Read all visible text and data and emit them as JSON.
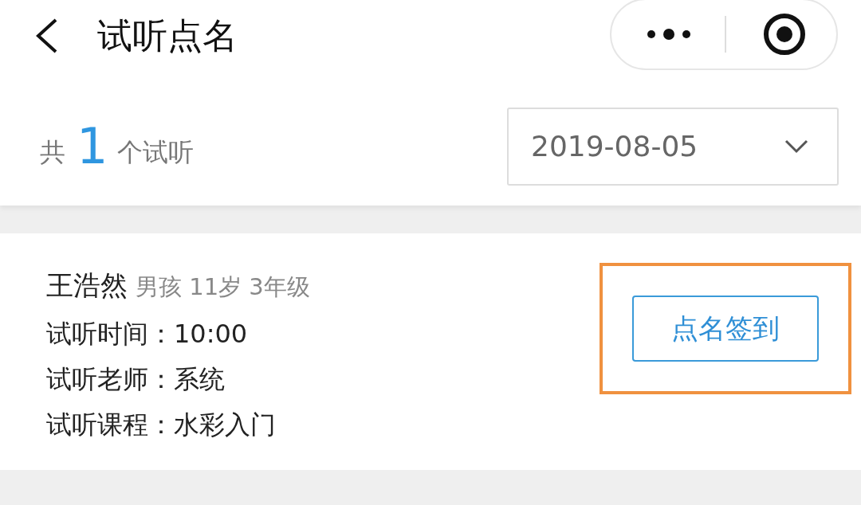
{
  "header": {
    "title": "试听点名"
  },
  "summary": {
    "prefix": "共",
    "count": "1",
    "suffix": "个试听"
  },
  "date_select": {
    "value": "2019-08-05"
  },
  "trials": [
    {
      "name": "王浩然",
      "info": "男孩 11岁 3年级",
      "fields": [
        {
          "label": "试听时间：",
          "value": "10:00"
        },
        {
          "label": "试听老师：",
          "value": "系统"
        },
        {
          "label": "试听课程：",
          "value": "水彩入门"
        }
      ],
      "button": "点名签到",
      "highlighted": true
    }
  ]
}
